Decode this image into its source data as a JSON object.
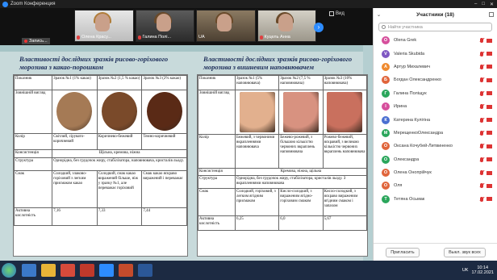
{
  "window": {
    "title": "Zoom Конференция"
  },
  "gallery": {
    "participants": [
      {
        "name": "Олена Красу..."
      },
      {
        "name": "Галина Полі..."
      },
      {
        "name": "UA"
      },
      {
        "name": "Куцель Анна"
      }
    ],
    "view_label": "Вид"
  },
  "recording": {
    "label": "Запись..."
  },
  "slide": {
    "left_title": "Властивості дослідних зразків рисово-горіхового морозива з какао-порошком",
    "right_title": "Властивості дослідних зразків рисово-горіхового морозива з вишневим наповнювачем",
    "left_table": {
      "headers": [
        "Показник",
        "Зразок №1 (1% какао)",
        "Зразок №2 (1,5 % какао)",
        "Зразок №3 (2% какао)"
      ],
      "rows": [
        [
          "Зовнішній вигляд",
          "",
          "",
          ""
        ],
        [
          "Колір",
          "Світлий, сірувато-коричневий",
          "Коричнево-бежевий",
          "Темно-коричневий"
        ],
        [
          "Консистенція",
          "Щільна, кремова, ніжна"
        ],
        [
          "Структура",
          "Однорідна, без грудочок жиру, стабілізатора, наповнювача, кристалів льоду."
        ],
        [
          "Смак",
          "Солодкий, злаково-горіховий з легким присмаком какао",
          "Солодкий, смак какао виражений більше, ніж у зразку №1, але переважає горіховий",
          "Смак какао яскраво виражений і переважає"
        ],
        [
          "Активна кислотність",
          "7,16",
          "7,33",
          "7,44"
        ]
      ],
      "swatch_colors": [
        "#a57a55",
        "#7a4a2a",
        "#5a2a16"
      ]
    },
    "right_table": {
      "headers": [
        "Показник",
        "Зразок №1 (5% наповнювача)",
        "Зразок №2 (7,5 % наповнювача)",
        "Зразок №3 (10% наповнювача)"
      ],
      "rows": [
        [
          "Зовнішній вигляд",
          "",
          "",
          ""
        ],
        [
          "Колір",
          "Бежевий, з червоними вкрапленнями наповнювача",
          "Бежево-рожевий, з більшою кількістю червоних вкраплень наповнювача",
          "Рожево-бежевий, яскравий, з великою кількістю червоних вкраплень наповнювача"
        ],
        [
          "Консистенція",
          "Кремова, ніжна, щільна"
        ],
        [
          "Структура",
          "Однорідна, без грудочок жиру, стабілізатора, кристалів льоду. З вкрапленнями наповнювача"
        ],
        [
          "Смак",
          "Солодкий, горіховий, з легким ягідним присмаком",
          "Кисло-солодкий, з вираженим ягідно-горіховим смаком",
          "Кисло-солодкий, з яскраво вираженим ягідним смаком і запахом"
        ],
        [
          "Активна кислотність",
          "6,25",
          "6,0",
          "5,67"
        ]
      ],
      "swatch_colors": [
        "#e2b08e",
        "#d89280",
        "#c9705e"
      ]
    }
  },
  "participants_panel": {
    "title": "Участники (18)",
    "search_placeholder": "Найти участника",
    "list": [
      {
        "initial": "O",
        "name": "Olena Grek",
        "color": "#d64f9c"
      },
      {
        "initial": "V",
        "name": "Valeria Skubida",
        "color": "#7e57c2"
      },
      {
        "initial": "А",
        "name": "Артур Михалевич",
        "color": "#ef8a2f"
      },
      {
        "initial": "Б",
        "name": "Богдан Олександренко",
        "color": "#e0653b"
      },
      {
        "initial": "Г",
        "name": "Галина Поліщук",
        "color": "#2aa65b"
      },
      {
        "initial": "І",
        "name": "Ирина",
        "color": "#d64f9c"
      },
      {
        "initial": "К",
        "name": "Катерина Кулігіна",
        "color": "#4a6fd1"
      },
      {
        "initial": "М",
        "name": "МерещенкоОлександра",
        "color": "#2aa65b"
      },
      {
        "initial": "О",
        "name": "Оксана Кочубей-Литвиненко",
        "color": "#e0653b"
      },
      {
        "initial": "О",
        "name": "Олександра",
        "color": "#2aa65b"
      },
      {
        "initial": "О",
        "name": "Олена Онопрійчук",
        "color": "#e0653b"
      },
      {
        "initial": "О",
        "name": "Оля",
        "color": "#e0653b"
      },
      {
        "initial": "Т",
        "name": "Тетяна Осьмак",
        "color": "#2aa65b"
      }
    ],
    "invite_label": "Пригласить",
    "mute_all_label": "Выкл. звук всех"
  },
  "taskbar": {
    "lang": "UK",
    "time": "10:14",
    "date": "17.02.2021"
  }
}
